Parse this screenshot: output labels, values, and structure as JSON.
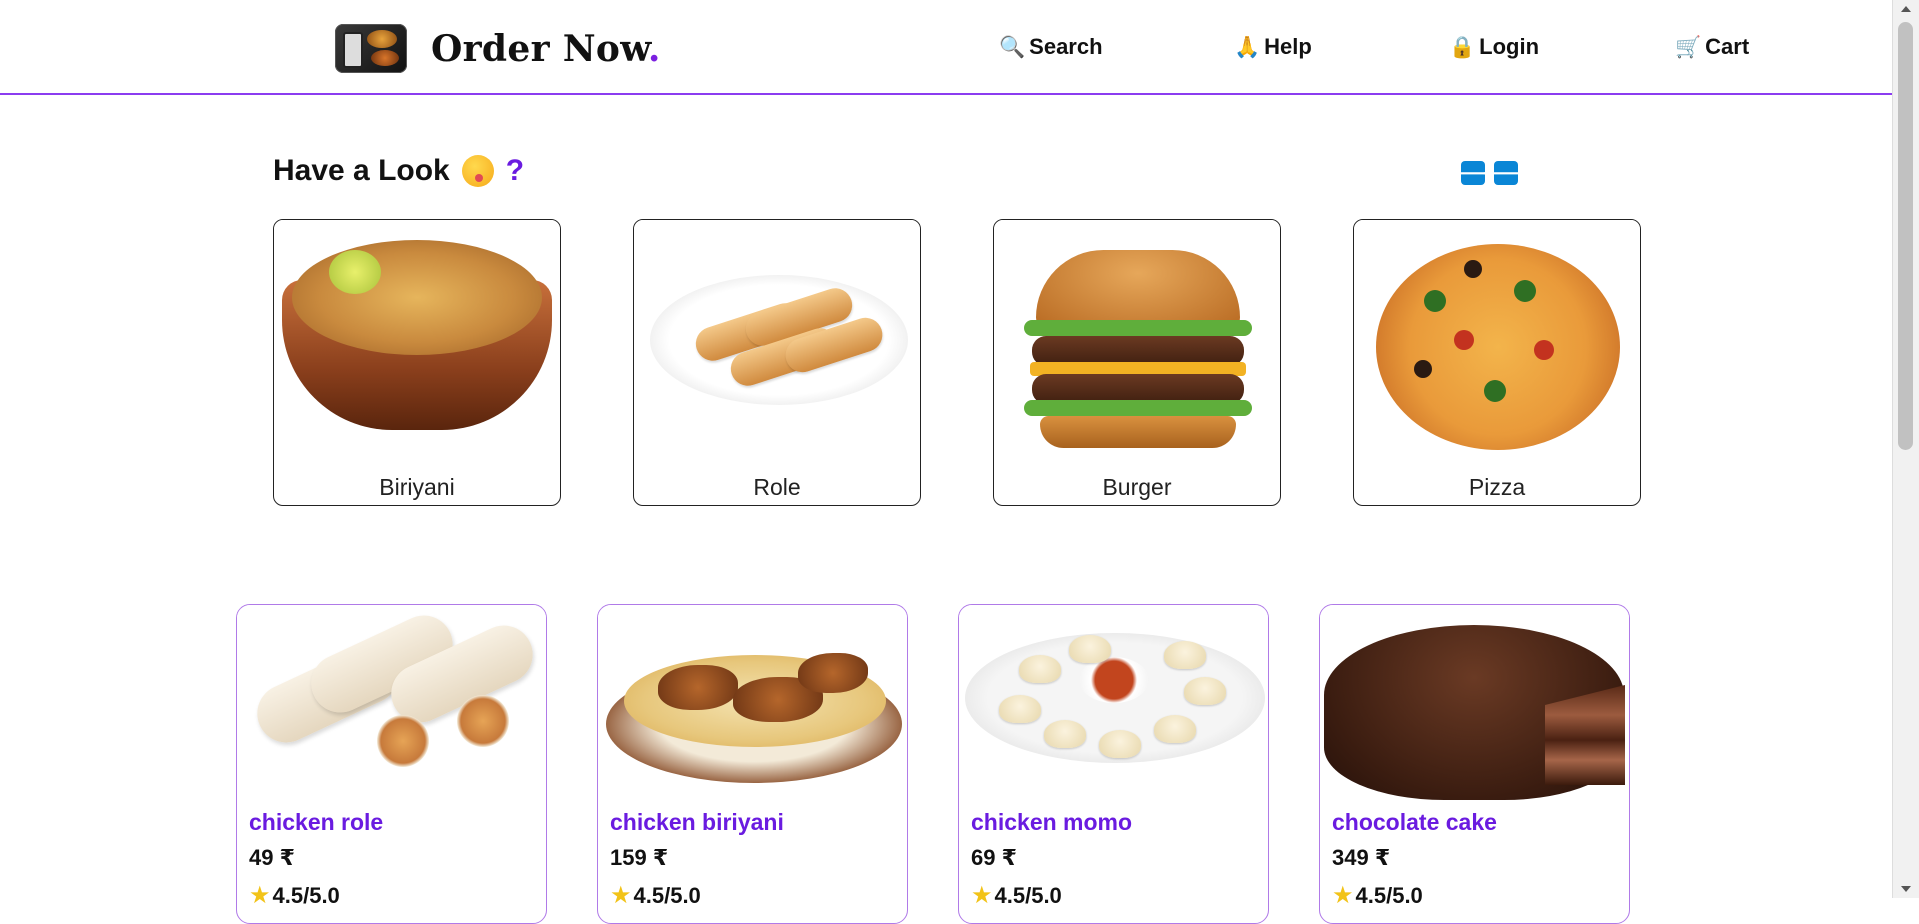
{
  "header": {
    "brand_text": "Order Now",
    "brand_dot": ".",
    "nav": {
      "search": {
        "icon": "search-icon",
        "label": "Search"
      },
      "help": {
        "icon": "help-icon",
        "label": "Help"
      },
      "login": {
        "icon": "lock-icon",
        "label": "Login"
      },
      "cart": {
        "icon": "cart-icon",
        "label": "Cart"
      }
    }
  },
  "section": {
    "title": "Have a Look",
    "question_mark": "?",
    "prev_arrow": "🡐",
    "next_arrow": "🡒"
  },
  "categories": [
    {
      "label": "Biriyani"
    },
    {
      "label": "Role"
    },
    {
      "label": "Burger"
    },
    {
      "label": "Pizza"
    }
  ],
  "products": [
    {
      "name": "chicken role",
      "price": "49 ₹",
      "rating": "4.5/5.0"
    },
    {
      "name": "chicken biriyani",
      "price": "159 ₹",
      "rating": "4.5/5.0"
    },
    {
      "name": "chicken momo",
      "price": "69 ₹",
      "rating": "4.5/5.0"
    },
    {
      "name": "chocolate cake",
      "price": "349 ₹",
      "rating": "4.5/5.0"
    }
  ],
  "colors": {
    "accent": "#7b1fe0",
    "header_border": "#8b3cf0",
    "arrow_button": "#0a86d6"
  }
}
